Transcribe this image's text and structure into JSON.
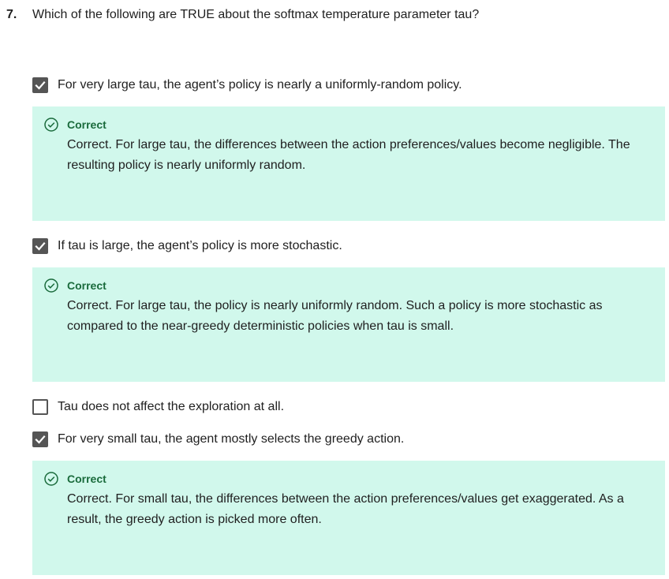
{
  "question": {
    "number": "7.",
    "text": "Which of the following are TRUE about the softmax temperature parameter tau?"
  },
  "options": [
    {
      "label": "For very large tau, the agent’s policy is nearly a uniformly-random policy.",
      "checked": true,
      "feedback": {
        "status": "Correct",
        "text": "Correct. For large tau, the differences between the action preferences/values become negligible. The resulting policy is nearly uniformly random."
      }
    },
    {
      "label": "If tau is large, the agent’s policy is more stochastic.",
      "checked": true,
      "feedback": {
        "status": "Correct",
        "text": "Correct. For large tau, the policy is nearly uniformly random. Such a policy is more stochastic as compared to the near-greedy deterministic policies when tau is small."
      }
    },
    {
      "label": "Tau does not affect the exploration at all.",
      "checked": false
    },
    {
      "label": "For very small tau, the agent mostly selects the greedy action.",
      "checked": true,
      "feedback": {
        "status": "Correct",
        "text": "Correct. For small tau, the differences between the action preferences/values get exaggerated. As a result, the greedy action is picked more often."
      }
    }
  ],
  "colors": {
    "feedback_background": "#d1f8ec",
    "correct_green": "#1a6b3c",
    "checkbox_gray": "#555555"
  },
  "icons": {
    "checkbox_checked": "checkmark-icon",
    "feedback_correct": "check-circle-icon"
  }
}
